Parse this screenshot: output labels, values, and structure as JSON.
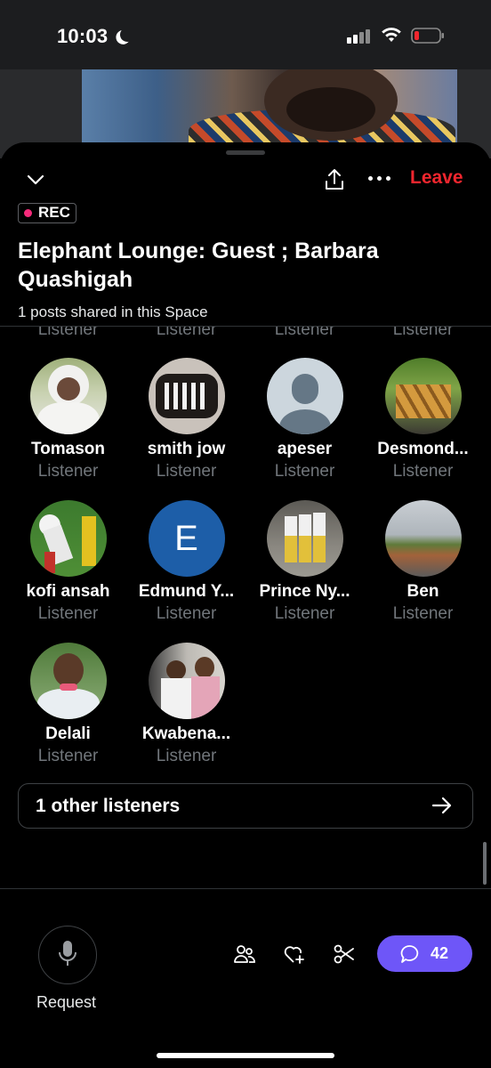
{
  "status_bar": {
    "time": "10:03",
    "icons": [
      "moon-icon",
      "signal-icon",
      "wifi-icon",
      "battery-low-icon"
    ]
  },
  "header": {
    "leave_label": "Leave",
    "rec_label": "REC",
    "title": "Elephant Lounge: Guest ; Barbara Quashigah",
    "posts_shared": "1 posts shared in this Space"
  },
  "partial_row_roles": [
    "Listener",
    "Listener",
    "Listener",
    "Listener"
  ],
  "participants": [
    {
      "name": "Tomason",
      "role": "Listener"
    },
    {
      "name": "smith jow",
      "role": "Listener"
    },
    {
      "name": "apeser",
      "role": "Listener"
    },
    {
      "name": "Desmond...",
      "role": "Listener"
    },
    {
      "name": "kofi ansah",
      "role": "Listener"
    },
    {
      "name": "Edmund Y...",
      "role": "Listener",
      "initial": "E"
    },
    {
      "name": "Prince Ny...",
      "role": "Listener"
    },
    {
      "name": "Ben",
      "role": "Listener"
    },
    {
      "name": "Delali",
      "role": "Listener"
    },
    {
      "name": "Kwabena...",
      "role": "Listener"
    }
  ],
  "other_listeners_label": "1 other listeners",
  "bottom_bar": {
    "request_label": "Request",
    "comments_count": "42"
  },
  "colors": {
    "accent_leave": "#f0262e",
    "rec_dot": "#f52a7a",
    "comments_button": "#6e56f8",
    "avatar_initial_bg": "#1d5ea8"
  }
}
